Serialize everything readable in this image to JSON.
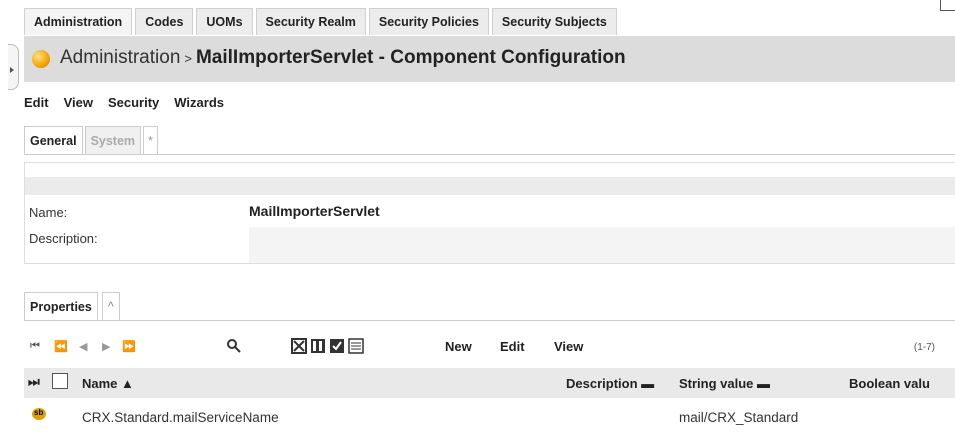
{
  "top_tabs": [
    "Administration",
    "Codes",
    "UOMs",
    "Security Realm",
    "Security Policies",
    "Security Subjects"
  ],
  "title": {
    "prefix": "Administration",
    "separator": ">",
    "component": "MailImporterServlet",
    "suffix": " - Component Configuration"
  },
  "menu": [
    "Edit",
    "View",
    "Security",
    "Wizards"
  ],
  "sub_tabs": {
    "general": "General",
    "system": "System",
    "extra": "*"
  },
  "fields": {
    "name_label": "Name:",
    "name_value": "MailImporterServlet",
    "description_label": "Description:"
  },
  "properties": {
    "tab_label": "Properties",
    "collapse_label": "^",
    "toolbar": {
      "new": "New",
      "edit": "Edit",
      "view": "View",
      "range": "(1-7)"
    },
    "columns": {
      "name": "Name",
      "description": "Description",
      "string_value": "String value",
      "boolean_value": "Boolean valu"
    },
    "rows": [
      {
        "name": "CRX.Standard.mailServiceName",
        "description": "",
        "string_value": "mail/CRX_Standard",
        "icon_text": "sb"
      }
    ]
  },
  "icons": {
    "title": "orange-ball-icon",
    "search": "magnifier-icon"
  },
  "colors": {
    "title_bar": "#dcdcdc",
    "icon_orange": "#f5a300"
  }
}
